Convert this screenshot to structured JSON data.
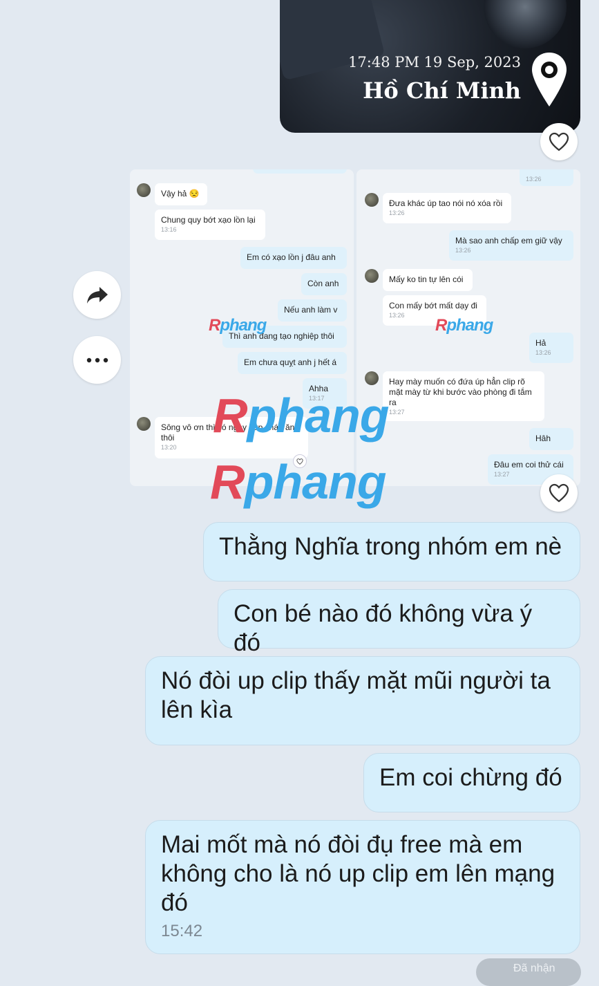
{
  "photo": {
    "timestamp": "17:48 PM 19 Sep, 2023",
    "location": "Hồ Chí Minh"
  },
  "screenshot": {
    "left": [
      {
        "text": "Vậy hả 😒",
        "time": ""
      },
      {
        "text": "Chung quy bớt xạo lồn lại",
        "time": "13:16"
      },
      {
        "text": "Em có xạo lồn j đâu anh",
        "time": ""
      },
      {
        "text": "Còn anh",
        "time": ""
      },
      {
        "text": "Nếu anh làm v",
        "time": ""
      },
      {
        "text": "Thì anh đang tạo nghiệp thôi",
        "time": ""
      },
      {
        "text": "Em chưa quỵt anh j hết á",
        "time": ""
      },
      {
        "text": "Ahha",
        "time": "13:17"
      },
      {
        "text": "Sông vô ơn thì có ngày húp cháo ăn thôi",
        "time": "13:20"
      }
    ],
    "right": [
      {
        "text": "",
        "time": "13:26"
      },
      {
        "text": "Đưa khác úp tao nói nó xóa rồi",
        "time": "13:26"
      },
      {
        "text": "Mà sao anh chấp em giữ vậy",
        "time": "13:26"
      },
      {
        "text": "Mấy ko tin tự lên cói",
        "time": ""
      },
      {
        "text": "Con mấy bớt mất dạy đi",
        "time": "13:26"
      },
      {
        "text": "Hả",
        "time": "13:26"
      },
      {
        "text": "Hay mày muốn có đứa úp hẳn clip rõ mặt mày từ khi bước vào phòng đi tắm ra",
        "time": "13:27"
      },
      {
        "text": "Hâh",
        "time": ""
      },
      {
        "text": "Đâu em coi thử cái",
        "time": "13:27"
      }
    ]
  },
  "watermark": {
    "brand": "Rphang"
  },
  "messages": [
    {
      "text": "Thằng Nghĩa trong nhóm em nè"
    },
    {
      "text": "Con bé nào đó không vừa ý đó"
    },
    {
      "text": "Nó đòi up clip thấy mặt mũi người ta lên kìa"
    },
    {
      "text": "Em coi chừng đó"
    },
    {
      "text": "Mai mốt mà nó đòi đụ free mà em không cho là nó up clip em lên mạng đó",
      "time": "15:42"
    }
  ],
  "bottom": {
    "label": "Đã nhận"
  },
  "icons": [
    "heart-icon",
    "forward-icon",
    "more-icon",
    "location-pin-icon"
  ],
  "colors": {
    "background": "#e2e9f1",
    "bubble": "#d6effc",
    "watermark_red": "#e24a59",
    "watermark_blue": "#3aa8e8"
  }
}
